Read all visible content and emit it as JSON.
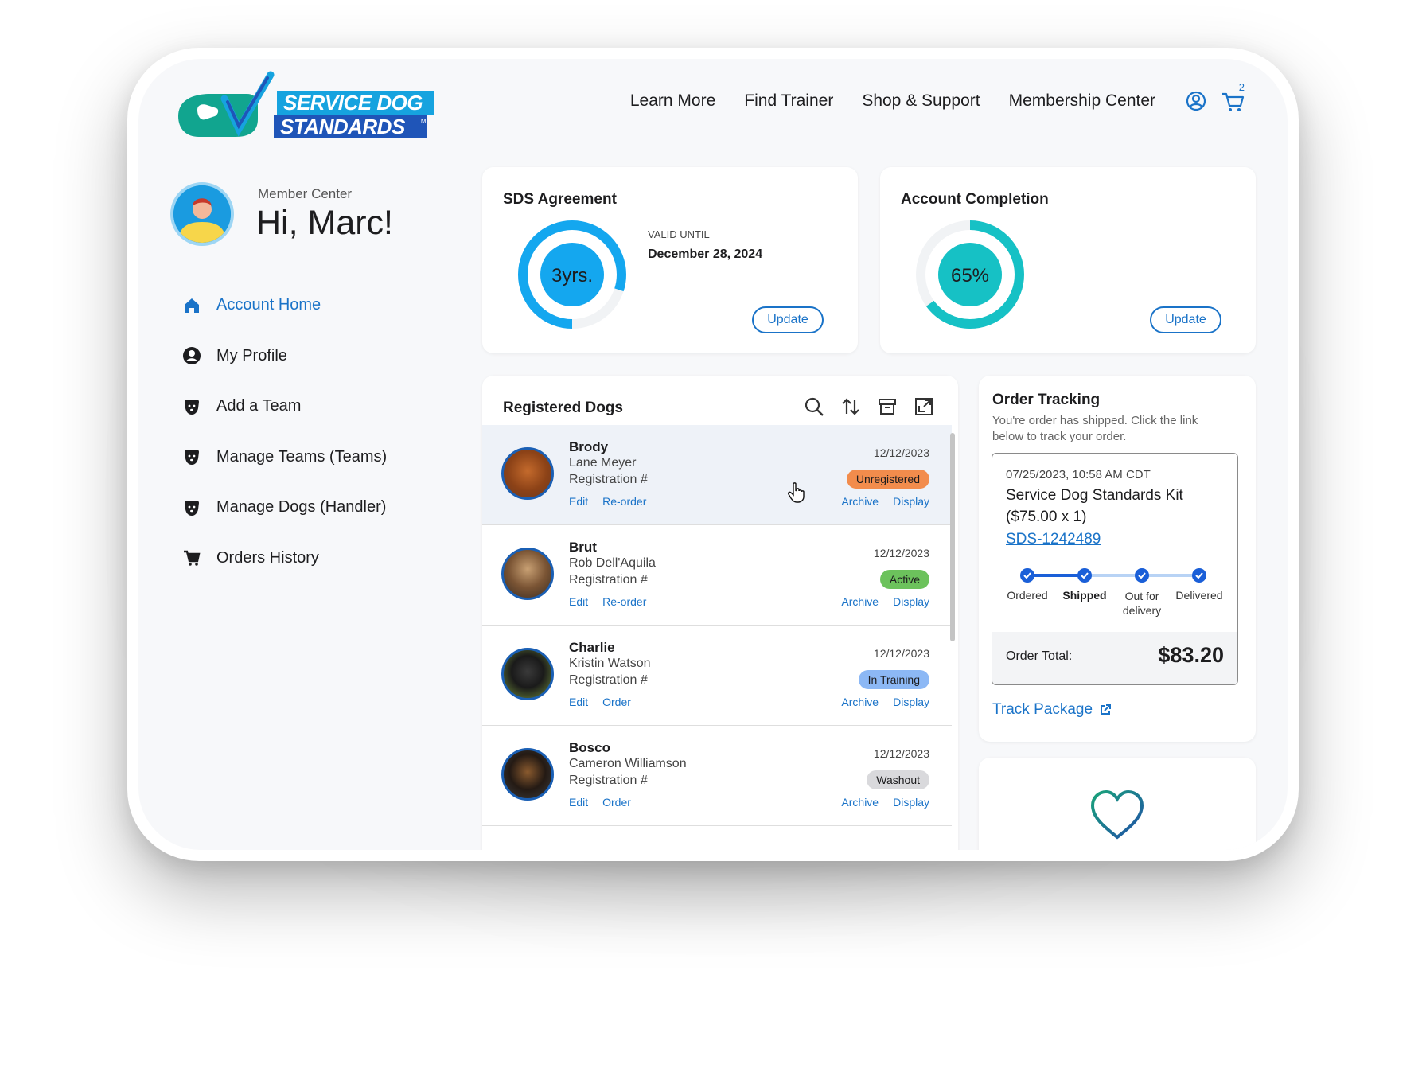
{
  "brand": {
    "line1": "SERVICE DOG",
    "line2": "STANDARDS",
    "tm": "TM",
    "colors": {
      "teal": "#11a58f",
      "blue": "#1f55b8",
      "cyan": "#16a3df"
    }
  },
  "nav": {
    "links": [
      "Learn More",
      "Find Trainer",
      "Shop & Support",
      "Membership Center"
    ],
    "cart_count": "2",
    "account_icon": "user-circle-icon",
    "cart_icon": "cart-icon"
  },
  "sidebar": {
    "member_label": "Member Center",
    "greeting": "Hi, Marc!",
    "items": [
      {
        "label": "Account Home",
        "icon": "home-icon",
        "active": true
      },
      {
        "label": "My Profile",
        "icon": "profile-icon",
        "active": false
      },
      {
        "label": "Add a Team",
        "icon": "dog-icon",
        "active": false
      },
      {
        "label": "Manage Teams (Teams)",
        "icon": "dog-icon",
        "active": false
      },
      {
        "label": "Manage Dogs (Handler)",
        "icon": "dog-icon",
        "active": false
      },
      {
        "label": "Orders History",
        "icon": "cart-icon",
        "active": false
      }
    ]
  },
  "agreement": {
    "title": "SDS Agreement",
    "ring_label": "3yrs.",
    "ring_fraction": 0.8,
    "valid_label": "VALID UNTIL",
    "valid_date": "December 28, 2024",
    "button": "Update"
  },
  "completion": {
    "title": "Account Completion",
    "ring_label": "65%",
    "ring_fraction": 0.65,
    "button": "Update"
  },
  "dogs": {
    "title": "Registered Dogs",
    "toolbar_icons": [
      "search-icon",
      "sort-icon",
      "archive-icon",
      "expand-icon"
    ],
    "rows": [
      {
        "name": "Brody",
        "owner": "Lane Meyer",
        "reg": "Registration #",
        "date": "12/12/2023",
        "status": "Unregistered",
        "status_color": "#f28c4c",
        "link1": "Edit",
        "link2": "Re-order",
        "action1": "Archive",
        "action2": "Display"
      },
      {
        "name": "Brut",
        "owner": "Rob Dell'Aquila",
        "reg": "Registration #",
        "date": "12/12/2023",
        "status": "Active",
        "status_color": "#6cc25c",
        "link1": "Edit",
        "link2": "Re-order",
        "action1": "Archive",
        "action2": "Display"
      },
      {
        "name": "Charlie",
        "owner": "Kristin Watson",
        "reg": "Registration #",
        "date": "12/12/2023",
        "status": "In Training",
        "status_color": "#8cb8f5",
        "link1": "Edit",
        "link2": "Order",
        "action1": "Archive",
        "action2": "Display"
      },
      {
        "name": "Bosco",
        "owner": "Cameron Williamson",
        "reg": "Registration #",
        "date": "12/12/2023",
        "status": "Washout",
        "status_color": "#d9d9dc",
        "link1": "Edit",
        "link2": "Order",
        "action1": "Archive",
        "action2": "Display"
      }
    ]
  },
  "order": {
    "title": "Order Tracking",
    "subtitle_line1": "You're order has shipped. Click the link",
    "subtitle_line2": "below to track your order.",
    "timestamp": "07/25/2023, 10:58 AM CDT",
    "item_line1": "Service Dog Standards Kit",
    "item_line2": "($75.00 x 1)",
    "order_id": "SDS-1242489",
    "steps": [
      {
        "line1": "Ordered",
        "line2": ""
      },
      {
        "line1": "Shipped",
        "line2": ""
      },
      {
        "line1": "Out for",
        "line2": "delivery"
      },
      {
        "line1": "Delivered",
        "line2": ""
      }
    ],
    "total_label": "Order Total:",
    "total_value": "$83.20",
    "track_link": "Track Package"
  },
  "promo": {
    "icon": "heart-icon"
  }
}
